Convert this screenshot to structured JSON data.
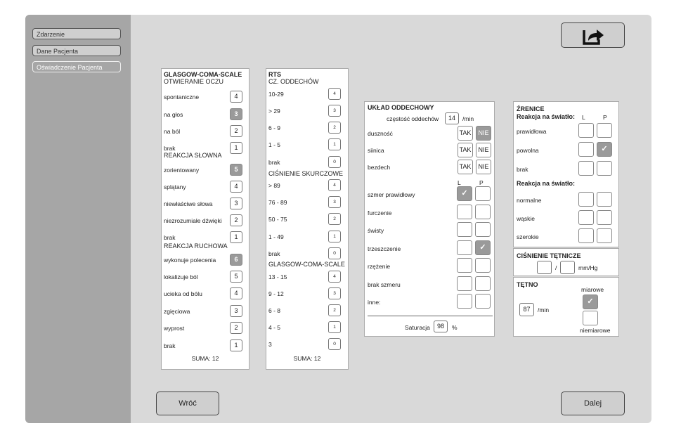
{
  "sidebar": {
    "items": [
      {
        "label": "Zdarzenie"
      },
      {
        "label": "Dane Pacjenta"
      },
      {
        "label": "Oświadczenie Pacjenta"
      }
    ]
  },
  "gcs": {
    "title": "GLASGOW-COMA-SCALE",
    "eyes_title": "OTWIERANIE OCZU",
    "eyes": [
      {
        "label": "spontaniczne",
        "value": "4"
      },
      {
        "label": "na głos",
        "value": "3"
      },
      {
        "label": "na ból",
        "value": "2"
      },
      {
        "label": "brak",
        "value": "1"
      }
    ],
    "verbal_title": "REAKCJA SŁOWNA",
    "verbal": [
      {
        "label": "zorientowany",
        "value": "5"
      },
      {
        "label": "splątany",
        "value": "4"
      },
      {
        "label": "niewłaściwe słowa",
        "value": "3"
      },
      {
        "label": "niezrozumiałe dźwięki",
        "value": "2"
      },
      {
        "label": "brak",
        "value": "1"
      }
    ],
    "motor_title": "REAKCJA RUCHOWA",
    "motor": [
      {
        "label": "wykonuje polecenia",
        "value": "6"
      },
      {
        "label": "lokalizuje ból",
        "value": "5"
      },
      {
        "label": "ucieka od bólu",
        "value": "4"
      },
      {
        "label": "zgięciowa",
        "value": "3"
      },
      {
        "label": "wyprost",
        "value": "2"
      },
      {
        "label": "brak",
        "value": "1"
      }
    ],
    "selected": {
      "eyes": "3",
      "verbal": "5",
      "motor": "6"
    },
    "sum": "SUMA: 12"
  },
  "rts": {
    "title": "RTS",
    "resp_title": "CZ. ODDECHÓW",
    "resp": [
      {
        "label": "10-29",
        "value": "4"
      },
      {
        "label": "> 29",
        "value": "3"
      },
      {
        "label": "6 - 9",
        "value": "2"
      },
      {
        "label": "1 - 5",
        "value": "1"
      },
      {
        "label": "brak",
        "value": "0"
      }
    ],
    "bp_title": "CIŚNIENIE SKURCZOWE",
    "bp": [
      {
        "label": "> 89",
        "value": "4"
      },
      {
        "label": "76 - 89",
        "value": "3"
      },
      {
        "label": "50 - 75",
        "value": "2"
      },
      {
        "label": "1 - 49",
        "value": "1"
      },
      {
        "label": "brak",
        "value": "0"
      }
    ],
    "gcs_title": "GLASGOW-COMA-SCALE",
    "gcs": [
      {
        "label": "13 - 15",
        "value": "4"
      },
      {
        "label": "9 - 12",
        "value": "3"
      },
      {
        "label": "6 - 8",
        "value": "2"
      },
      {
        "label": "4 - 5",
        "value": "1"
      },
      {
        "label": "3",
        "value": "0"
      }
    ],
    "sum": "SUMA: 12"
  },
  "resp_system": {
    "title": "UKŁAD ODDECHOWY",
    "rate_label": "częstość oddechów",
    "rate_value": "14",
    "rate_unit": "/min",
    "yes": "TAK",
    "no": "NIE",
    "yn_rows": [
      {
        "label": "duszność",
        "answer": "NIE"
      },
      {
        "label": "siinica",
        "answer": "none"
      },
      {
        "label": "bezdech",
        "answer": "none"
      }
    ],
    "col_l": "L",
    "col_p": "P",
    "lp_rows": [
      {
        "label": "szmer prawidłowy",
        "l": true,
        "p": false
      },
      {
        "label": "furczenie",
        "l": false,
        "p": false
      },
      {
        "label": "świsty",
        "l": false,
        "p": false
      },
      {
        "label": "trzeszczenie",
        "l": false,
        "p": true
      },
      {
        "label": "rzężenie",
        "l": false,
        "p": false
      },
      {
        "label": "brak szmeru",
        "l": false,
        "p": false
      },
      {
        "label": "inne:",
        "l": false,
        "p": false
      }
    ],
    "saturation_label": "Saturacja",
    "saturation_value": "98",
    "saturation_unit": "%"
  },
  "pupils": {
    "title": "ŹRENICE",
    "light_title": "Reakcja na światło:",
    "col_l": "L",
    "col_p": "P",
    "light_rows": [
      {
        "label": "prawidłowa",
        "l": false,
        "p": false
      },
      {
        "label": "powolna",
        "l": false,
        "p": true
      },
      {
        "label": "brak",
        "l": false,
        "p": false
      }
    ],
    "size_title": "Reakcja na światło:",
    "size_rows": [
      {
        "label": "normalne",
        "l": false,
        "p": false
      },
      {
        "label": "wąskie",
        "l": false,
        "p": false
      },
      {
        "label": "szerokie",
        "l": false,
        "p": false
      }
    ]
  },
  "blood_pressure": {
    "title": "CIŚNIENIE TĘTNICZE",
    "systolic": "",
    "diastolic": "",
    "separator": "/",
    "unit": "mm/Hg"
  },
  "pulse": {
    "title": "TĘTNO",
    "value": "87",
    "unit": "/min",
    "regular_label": "miarowe",
    "regular_checked": true,
    "irregular_label": "niemiarowe",
    "irregular_checked": false
  },
  "buttons": {
    "back": "Wróć",
    "next": "Dalej",
    "export_icon": "share-export-icon"
  },
  "check_glyph": "✓"
}
